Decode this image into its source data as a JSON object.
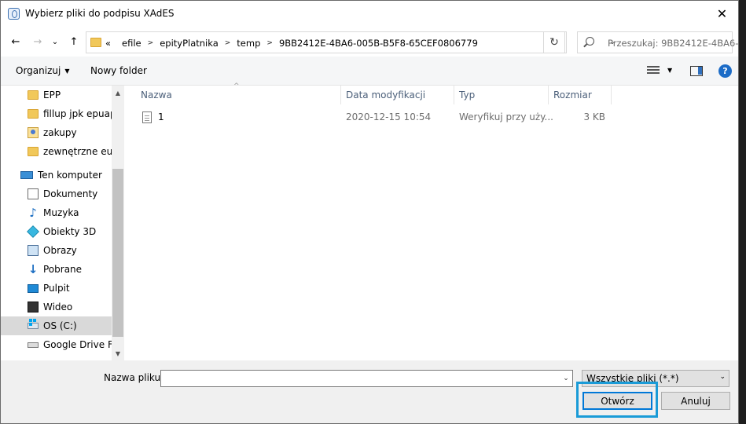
{
  "window": {
    "title": "Wybierz pliki do podpisu XAdES",
    "close_glyph": "✕"
  },
  "nav": {
    "back_glyph": "←",
    "forward_glyph": "→",
    "recent_glyph": "⌄",
    "up_glyph": "↑",
    "breadcrumb": [
      "«",
      "efile",
      "epityPlatnika",
      "temp",
      "9BB2412E-4BA6-005B-B5F8-65CEF0806779"
    ],
    "refresh_glyph": "↻",
    "search_placeholder": "Przeszukaj: 9BB2412E-4BA6-..."
  },
  "toolbar": {
    "organize_label": "Organizuj",
    "new_folder_label": "Nowy folder",
    "help_glyph": "?"
  },
  "sidebar": {
    "items": [
      {
        "label": "EPP",
        "icon": "folder-icon"
      },
      {
        "label": "fillup jpk epuap",
        "icon": "folder-icon"
      },
      {
        "label": "zakupy",
        "icon": "contact-folder-icon"
      },
      {
        "label": "zewnętrzne euro",
        "icon": "folder-icon"
      },
      {
        "label": "Ten komputer",
        "icon": "computer-icon"
      },
      {
        "label": "Dokumenty",
        "icon": "documents-icon"
      },
      {
        "label": "Muzyka",
        "icon": "music-icon"
      },
      {
        "label": "Obiekty 3D",
        "icon": "3d-objects-icon"
      },
      {
        "label": "Obrazy",
        "icon": "pictures-icon"
      },
      {
        "label": "Pobrane",
        "icon": "downloads-icon"
      },
      {
        "label": "Pulpit",
        "icon": "desktop-icon"
      },
      {
        "label": "Wideo",
        "icon": "video-icon"
      },
      {
        "label": "OS (C:)",
        "icon": "drive-icon",
        "selected": true
      },
      {
        "label": "Google Drive File",
        "icon": "network-drive-icon"
      }
    ]
  },
  "filelist": {
    "columns": [
      "Nazwa",
      "Data modyfikacji",
      "Typ",
      "Rozmiar"
    ],
    "rows": [
      {
        "name": "1",
        "modified": "2020-12-15 10:54",
        "type": "Weryfikuj przy uży...",
        "size": "3 KB"
      }
    ]
  },
  "bottom": {
    "filename_label": "Nazwa pliku:",
    "filename_value": "",
    "filter_value": "Wszystkie pliki (*.*)",
    "open_label": "Otwórz",
    "cancel_label": "Anuluj"
  }
}
